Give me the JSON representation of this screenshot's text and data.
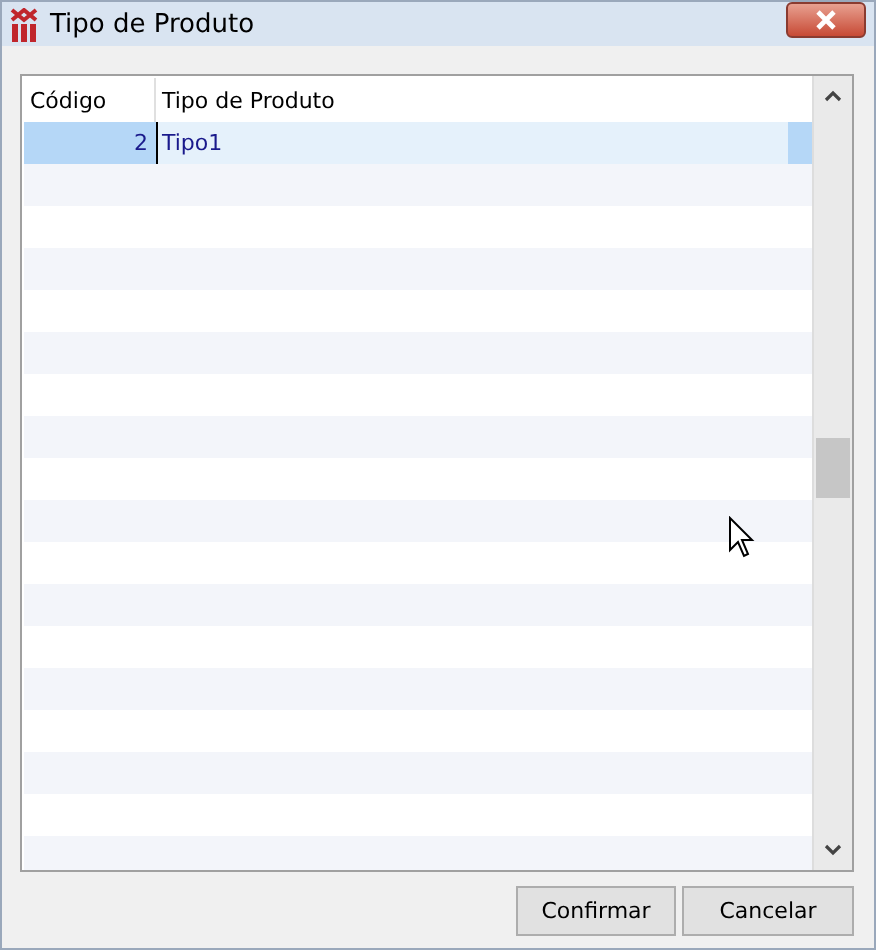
{
  "window": {
    "title": "Tipo de Produto"
  },
  "table": {
    "columns": [
      "Código",
      "Tipo de Produto"
    ],
    "rows": [
      {
        "cells": [
          "2",
          "Tipo1"
        ],
        "selected": true
      }
    ]
  },
  "buttons": [
    "Confirmar",
    "Cancelar"
  ]
}
